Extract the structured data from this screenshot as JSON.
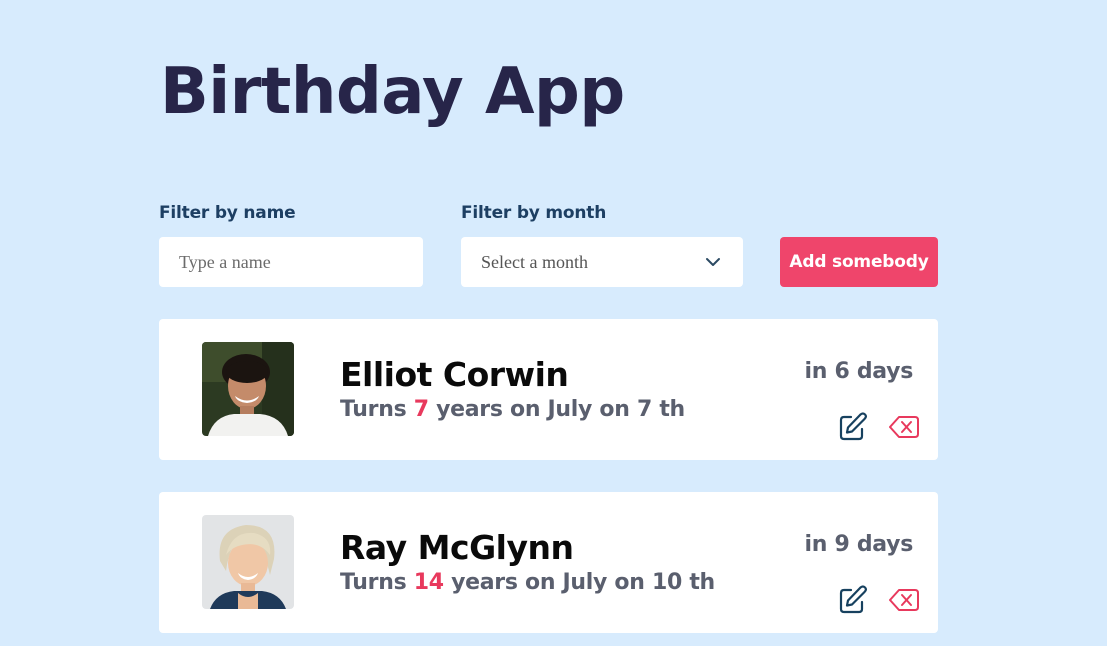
{
  "app": {
    "title": "Birthday App"
  },
  "filters": {
    "name_label": "Filter by name",
    "name_placeholder": "Type a name",
    "name_value": "",
    "month_label": "Filter by month",
    "month_placeholder": "Select a month"
  },
  "actions": {
    "add_label": "Add somebody"
  },
  "people": [
    {
      "name": "Elliot Corwin",
      "turns_prefix": "Turns",
      "age": "7",
      "date_text": "years on July on 7 th",
      "countdown": "in 6 days"
    },
    {
      "name": "Ray McGlynn",
      "turns_prefix": "Turns",
      "age": "14",
      "date_text": "years on July on 10 th",
      "countdown": "in 9 days"
    }
  ],
  "icons": {
    "select_chevron": "chevron-down-icon",
    "edit": "edit-icon",
    "delete": "delete-icon"
  },
  "colors": {
    "background": "#d7ebfd",
    "title": "#272549",
    "label": "#1d3f63",
    "accent": "#ef456b",
    "age_highlight": "#e8395d",
    "muted_text": "#5a5f6e",
    "edit_icon": "#17415f",
    "delete_icon": "#e8395d"
  }
}
